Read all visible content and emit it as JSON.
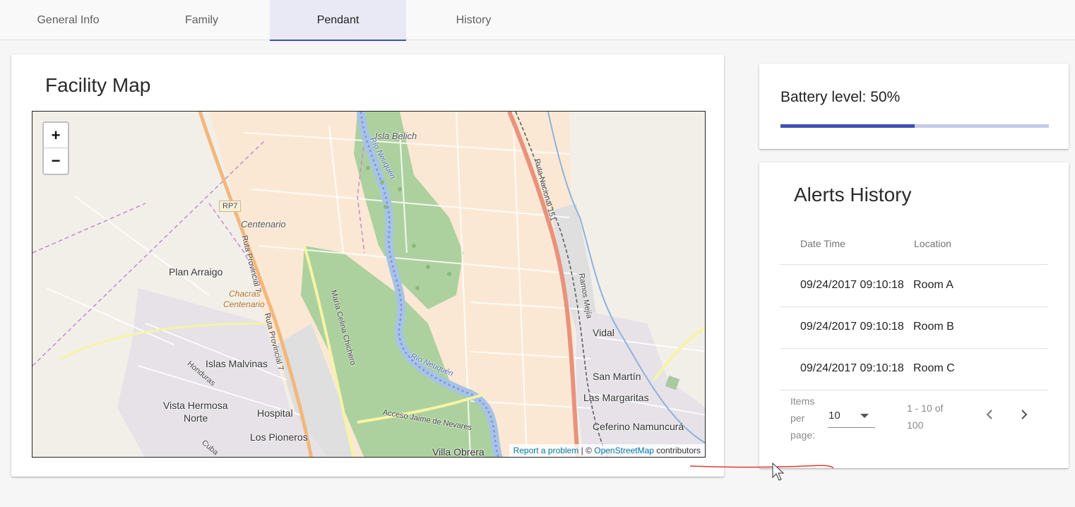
{
  "tabs": [
    {
      "label": "General Info"
    },
    {
      "label": "Family"
    },
    {
      "label": "Pendant"
    },
    {
      "label": "History"
    }
  ],
  "active_tab": "Pendant",
  "map_card": {
    "title": "Facility Map",
    "zoom_in": "+",
    "zoom_out": "−",
    "attribution": {
      "report": "Report a problem",
      "sep": " | © ",
      "osm": "OpenStreetMap",
      "contributors": " contributors"
    },
    "labels": {
      "isla_belich": "Isla Belich",
      "rp7": "RP7",
      "centenario": "Centenario",
      "plan_arraigo": "Plan Arraigo",
      "chacras_1": "Chacras",
      "chacras_2": "Centenario",
      "islas_malvinas": "Islas Malvinas",
      "vista_hermosa_1": "Vista Hermosa",
      "vista_hermosa_2": "Norte",
      "hospital": "Hospital",
      "los_pioneros": "Los Pioneros",
      "villa_obrera": "Villa Obrera",
      "vidal": "Vidal",
      "san_martin": "San Martín",
      "las_margaritas": "Las Margaritas",
      "ceferino": "Ceferino Namuncurá",
      "rio_neuquen_1": "Río Neuquén",
      "rio_neuquen_2": "Río Neuquén",
      "ruta_provincial_1": "Ruta Provincial 7",
      "ruta_provincial_2": "Ruta Provincial 7",
      "ruta_nacional": "Ruta Nacional 151",
      "maria_celina": "María Celina Chichero",
      "ramos_mejia": "Ramos Mejía",
      "acceso": "Acceso Jaime de Nevares",
      "honduras": "Honduras",
      "cuba": "Cuba"
    }
  },
  "battery": {
    "label": "Battery level: 50%",
    "level_percent": 50,
    "fill_color": "#3f51b5",
    "track_color": "#c5cae9"
  },
  "alerts": {
    "title": "Alerts History",
    "columns": [
      "Date Time",
      "Location"
    ],
    "rows": [
      {
        "datetime": "09/24/2017 09:10:18",
        "location": "Room A"
      },
      {
        "datetime": "09/24/2017 09:10:18",
        "location": "Room B"
      },
      {
        "datetime": "09/24/2017 09:10:18",
        "location": "Room C"
      }
    ],
    "pager": {
      "items_per_page_label": "Items per page:",
      "page_size": "10",
      "range": "1 - 10 of 100",
      "prev_icon": "chevron-left-icon",
      "next_icon": "chevron-right-icon"
    }
  }
}
